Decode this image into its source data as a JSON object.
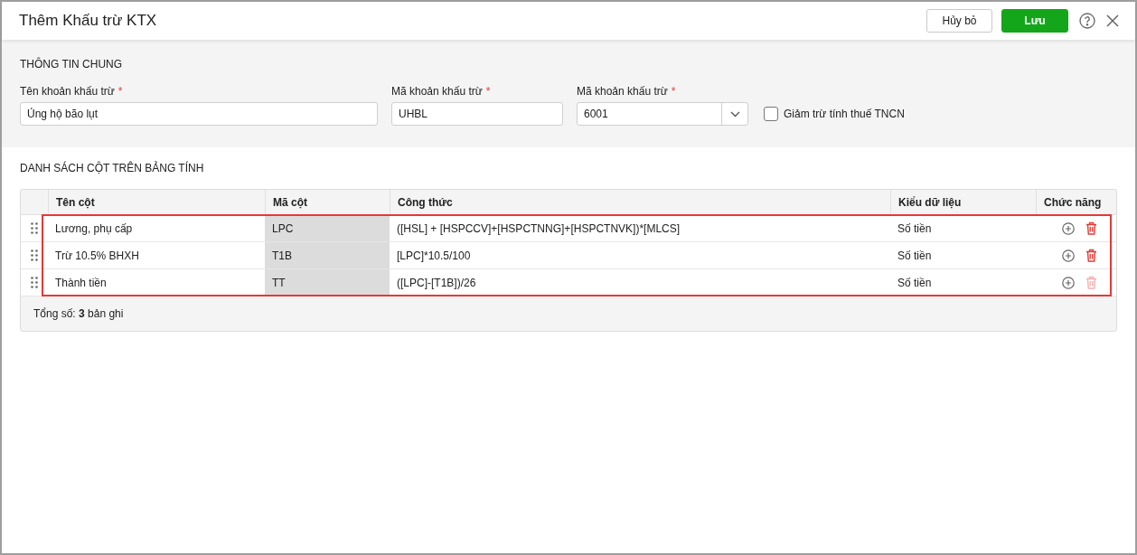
{
  "window": {
    "title": "Thêm Khấu trừ KTX"
  },
  "header_buttons": [
    {
      "label": "Hủy bỏ",
      "kind": "secondary"
    },
    {
      "label": "Lưu",
      "kind": "primary"
    }
  ],
  "general": {
    "title": "THÔNG TIN CHUNG",
    "fields": [
      {
        "kind": "text",
        "label": "Tên khoản khấu trừ",
        "required_mark": "*",
        "value": "Ủng hộ bão lụt"
      },
      {
        "kind": "text",
        "label": "Mã khoản khấu trừ",
        "required_mark": "*",
        "value": "UHBL"
      },
      {
        "kind": "select",
        "label": "Mã khoản khấu trừ",
        "required_mark": "*",
        "value": "6001"
      },
      {
        "kind": "checkbox",
        "label": "Giảm trừ tính thuế TNCN",
        "checked": false
      }
    ]
  },
  "columns_section": {
    "title": "DANH SÁCH CỘT TRÊN BẢNG TÍNH",
    "table": {
      "columns": [
        "Tên cột",
        "Mã cột",
        "Công thức",
        "Kiểu dữ liệu",
        "Chức năng"
      ],
      "highlighted": true,
      "rows": [
        {
          "name": "Lương, phụ cấp",
          "code": "LPC",
          "formula": "([HSL] + [HSPCCV]+[HSPCTNNG]+[HSPCTNVK])*[MLCS]",
          "type": "Số tiền",
          "delete_disabled": false
        },
        {
          "name": "Trừ 10.5% BHXH",
          "code": "T1B",
          "formula": "[LPC]*10.5/100",
          "type": "Số tiền",
          "delete_disabled": false
        },
        {
          "name": "Thành tiền",
          "code": "TT",
          "formula": "([LPC]-[T1B])/26",
          "type": "Số tiền",
          "delete_disabled": true
        }
      ],
      "footer": "Tổng số: **3** bản ghi"
    }
  }
}
